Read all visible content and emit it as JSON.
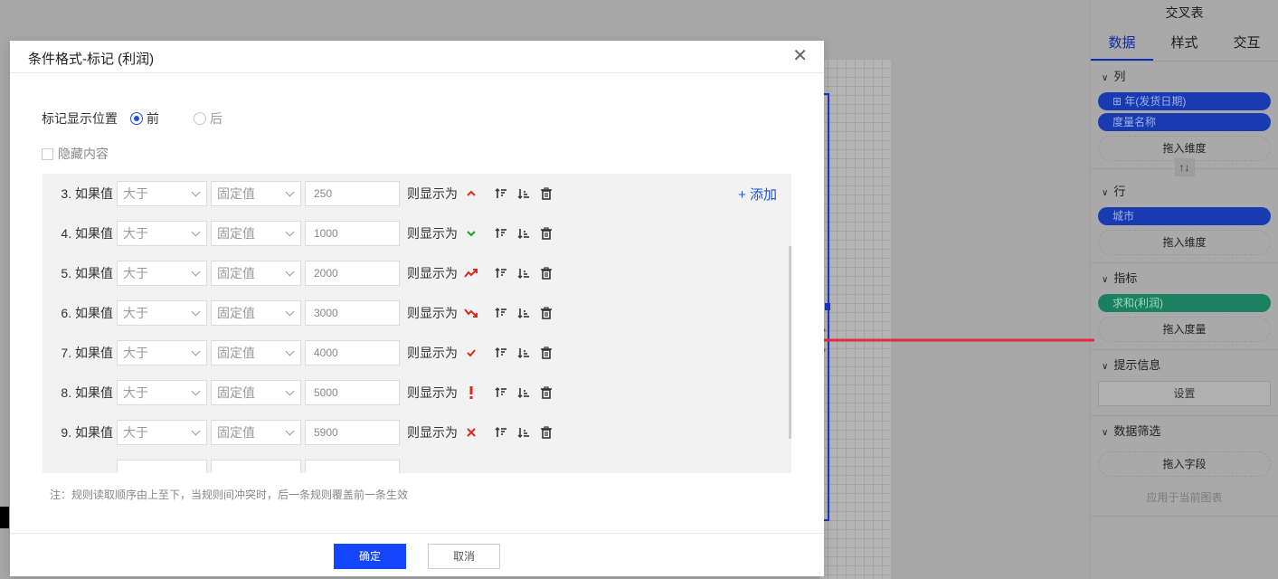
{
  "right_panel": {
    "title": "交叉表",
    "tabs": [
      "数据",
      "样式",
      "交互"
    ],
    "sections": {
      "columns": {
        "label": "列",
        "pills": [
          "⊞ 年(发货日期)",
          "度量名称"
        ],
        "drop": "拖入维度"
      },
      "rows": {
        "label": "行",
        "pills": [
          "城市"
        ],
        "drop": "拖入维度"
      },
      "metrics": {
        "label": "指标",
        "pills": [
          "求和(利润)"
        ],
        "drop": "拖入度量"
      },
      "tooltip": {
        "label": "提示信息",
        "button": "设置"
      },
      "filter": {
        "label": "数据筛选",
        "drop": "拖入字段",
        "apply": "应用于当前图表"
      }
    },
    "swap_icon": "↑↓"
  },
  "dialog": {
    "title": "条件格式-标记 (利润)",
    "position_label": "标记显示位置",
    "position_options": [
      "前",
      "后"
    ],
    "position_selected": "前",
    "hide_content_label": "隐藏内容",
    "add_label": "+ 添加",
    "rules": [
      {
        "index": "3.",
        "label": "如果值",
        "op": "大于",
        "type": "固定值",
        "value": "250",
        "show": "则显示为",
        "mark": "chevron-up",
        "color": "#e0281b"
      },
      {
        "index": "4.",
        "label": "如果值",
        "op": "大于",
        "type": "固定值",
        "value": "1000",
        "show": "则显示为",
        "mark": "chevron-down",
        "color": "#1aa229"
      },
      {
        "index": "5.",
        "label": "如果值",
        "op": "大于",
        "type": "固定值",
        "value": "2000",
        "show": "则显示为",
        "mark": "trend-up",
        "color": "#e0281b"
      },
      {
        "index": "6.",
        "label": "如果值",
        "op": "大于",
        "type": "固定值",
        "value": "3000",
        "show": "则显示为",
        "mark": "trend-down",
        "color": "#e0281b"
      },
      {
        "index": "7.",
        "label": "如果值",
        "op": "大于",
        "type": "固定值",
        "value": "4000",
        "show": "则显示为",
        "mark": "check",
        "color": "#e0281b"
      },
      {
        "index": "8.",
        "label": "如果值",
        "op": "大于",
        "type": "固定值",
        "value": "5000",
        "show": "则显示为",
        "mark": "exclamation",
        "color": "#e0281b"
      },
      {
        "index": "9.",
        "label": "如果值",
        "op": "大于",
        "type": "固定值",
        "value": "5900",
        "show": "则显示为",
        "mark": "cross",
        "color": "#e0281b"
      }
    ],
    "note": "注：规则读取顺序由上至下，当规则间冲突时，后一条规则覆盖前一条生效",
    "ok_label": "确定",
    "cancel_label": "取消",
    "close_icon": "close-icon"
  },
  "colors": {
    "primary": "#1446ff",
    "arrow": "#e8283c",
    "green_pill": "#1a805f"
  }
}
